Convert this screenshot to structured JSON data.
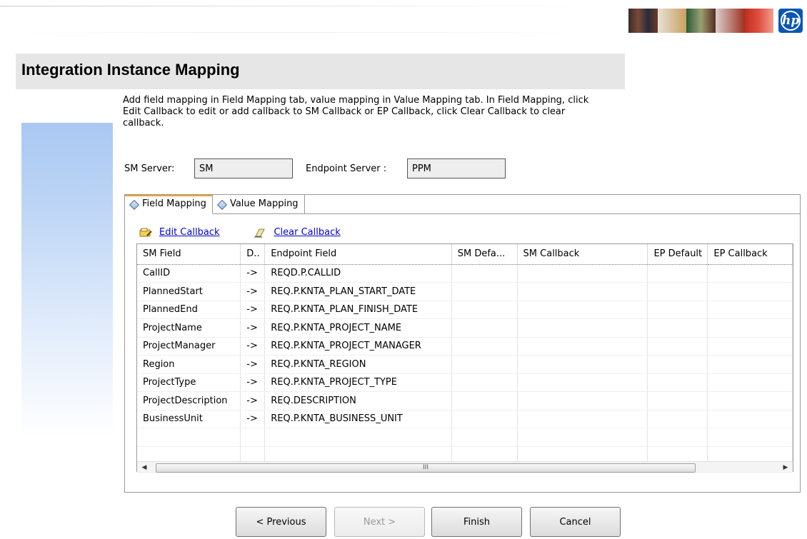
{
  "header": {
    "title": "Integration Instance Mapping",
    "logo_text": "hp"
  },
  "description": "Add field mapping in Field Mapping tab, value mapping in Value Mapping tab. In Field Mapping, click Edit Callback to edit or add callback to SM Callback or EP Callback, click Clear Callback to clear callback.",
  "servers": {
    "sm_label": "SM Server:",
    "sm_value": "SM",
    "endpoint_label": "Endpoint Server :",
    "endpoint_value": "PPM"
  },
  "tabs": [
    {
      "label": "Field Mapping",
      "active": true
    },
    {
      "label": "Value Mapping",
      "active": false
    }
  ],
  "toolbar": {
    "edit_callback": "Edit Callback",
    "clear_callback": "Clear Callback"
  },
  "table": {
    "columns": [
      "SM Field",
      "D..",
      "Endpoint Field",
      "SM Defa...",
      "SM Callback",
      "EP Default",
      "EP Callback"
    ],
    "rows": [
      [
        "CallID",
        "->",
        "REQD.P.CALLID",
        "",
        "",
        "",
        ""
      ],
      [
        "PlannedStart",
        "->",
        "REQ.P.KNTA_PLAN_START_DATE",
        "",
        "",
        "",
        ""
      ],
      [
        "PlannedEnd",
        "->",
        "REQ.P.KNTA_PLAN_FINISH_DATE",
        "",
        "",
        "",
        ""
      ],
      [
        "ProjectName",
        "->",
        "REQ.P.KNTA_PROJECT_NAME",
        "",
        "",
        "",
        ""
      ],
      [
        "ProjectManager",
        "->",
        "REQ.P.KNTA_PROJECT_MANAGER",
        "",
        "",
        "",
        ""
      ],
      [
        "Region",
        "->",
        "REQ.P.KNTA_REGION",
        "",
        "",
        "",
        ""
      ],
      [
        "ProjectType",
        "->",
        "REQ.P.KNTA_PROJECT_TYPE",
        "",
        "",
        "",
        ""
      ],
      [
        "ProjectDescription",
        "->",
        "REQ.DESCRIPTION",
        "",
        "",
        "",
        ""
      ],
      [
        "BusinessUnit",
        "->",
        "REQ.P.KNTA_BUSINESS_UNIT",
        "",
        "",
        "",
        ""
      ]
    ],
    "scroll_thumb_text": "III"
  },
  "buttons": {
    "previous": "< Previous",
    "next": "Next >",
    "finish": "Finish",
    "cancel": "Cancel"
  },
  "colors": {
    "link": "#0000cc",
    "title_bar": "#e6e6e6",
    "tab_accent": "#f0a030",
    "hp_blue": "#0a55b5"
  }
}
